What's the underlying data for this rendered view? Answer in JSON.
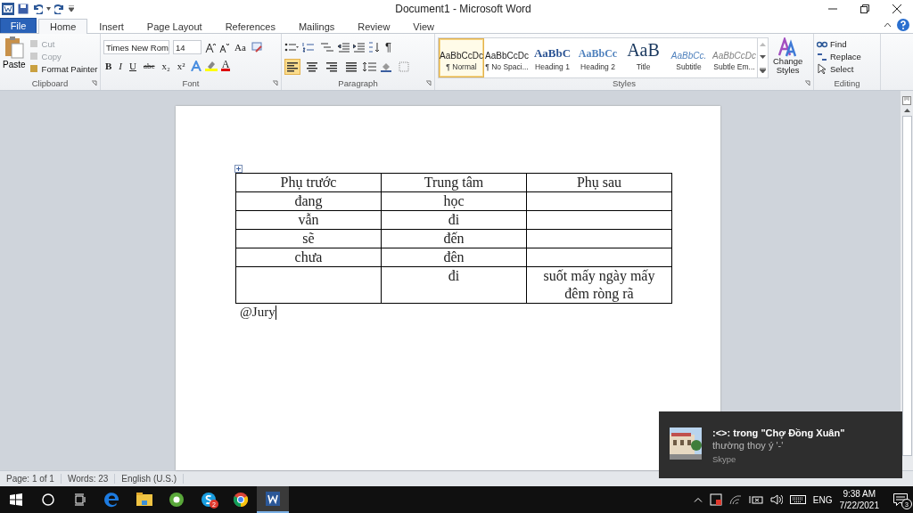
{
  "window": {
    "title": "Document1 - Microsoft Word"
  },
  "tabs": [
    {
      "label": "File",
      "kind": "file",
      "selected": false
    },
    {
      "label": "Home",
      "kind": "tab",
      "selected": true
    },
    {
      "label": "Insert",
      "kind": "tab",
      "selected": false
    },
    {
      "label": "Page Layout",
      "kind": "tab",
      "selected": false
    },
    {
      "label": "References",
      "kind": "tab",
      "selected": false
    },
    {
      "label": "Mailings",
      "kind": "tab",
      "selected": false
    },
    {
      "label": "Review",
      "kind": "tab",
      "selected": false
    },
    {
      "label": "View",
      "kind": "tab",
      "selected": false
    }
  ],
  "clipboard": {
    "label": "Clipboard",
    "paste": "Paste",
    "items": [
      {
        "label": "Cut",
        "disabled": true
      },
      {
        "label": "Copy",
        "disabled": true
      },
      {
        "label": "Format Painter",
        "disabled": false
      }
    ]
  },
  "font": {
    "label": "Font",
    "font_name": "Times New Rom",
    "font_size": "14",
    "case_button": "Aa",
    "format_buttons": [
      "B",
      "I",
      "U",
      "abc",
      "x₂",
      "x²"
    ],
    "color_letter": "A"
  },
  "paragraph": {
    "label": "Paragraph",
    "pilcrow": "¶",
    "align": [
      {
        "kind": "left",
        "selected": true
      },
      {
        "kind": "center",
        "selected": false
      },
      {
        "kind": "right",
        "selected": false
      },
      {
        "kind": "justify",
        "selected": false
      }
    ]
  },
  "styles": {
    "label": "Styles",
    "gallery": [
      {
        "kind": "normal",
        "preview": "AaBbCcDc",
        "name": "¶ Normal",
        "selected": true
      },
      {
        "kind": "nospacing",
        "preview": "AaBbCcDc",
        "name": "¶ No Spaci...",
        "selected": false
      },
      {
        "kind": "heading1",
        "preview": "AaBbC",
        "name": "Heading 1",
        "selected": false
      },
      {
        "kind": "heading2",
        "preview": "AaBbCc",
        "name": "Heading 2",
        "selected": false
      },
      {
        "kind": "title",
        "preview": "AaB",
        "name": "Title",
        "selected": false
      },
      {
        "kind": "subtitle",
        "preview": "AaBbCc.",
        "name": "Subtitle",
        "selected": false
      },
      {
        "kind": "subtle",
        "preview": "AaBbCcDc",
        "name": "Subtle Em...",
        "selected": false
      }
    ],
    "change_styles": [
      "Change",
      "Styles"
    ]
  },
  "editing": {
    "label": "Editing",
    "items": [
      "Find",
      "Replace",
      "Select"
    ]
  },
  "document": {
    "table": {
      "header": [
        "Phụ trước",
        "Trung tâm",
        "Phụ sau"
      ],
      "rows": [
        [
          "đang",
          "học",
          ""
        ],
        [
          "vẫn",
          "đi",
          ""
        ],
        [
          "sẽ",
          "đến",
          ""
        ],
        [
          "chưa",
          "đên",
          ""
        ],
        [
          "",
          "đi",
          "suốt mấy ngày mấy đêm ròng rã"
        ]
      ]
    },
    "text": "@Jury"
  },
  "status_bar": [
    "Page: 1 of 1",
    "Words: 23",
    "English (U.S.)"
  ],
  "notification": {
    "title": ":<>: trong \"Chợ Đồng Xuân\"",
    "message": "thường thoy ý '-'",
    "app": "Skype"
  },
  "taskbar": {
    "skype_badge": "2",
    "language": "ENG",
    "time": "9:38 AM",
    "date": "7/22/2021",
    "notification_count": "3"
  }
}
